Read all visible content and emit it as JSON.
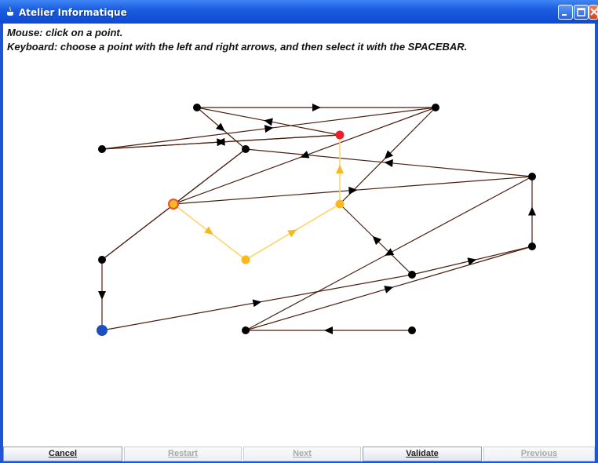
{
  "window": {
    "title": "Atelier Informatique"
  },
  "instructions": {
    "mouse": "Mouse: click on a point.",
    "keyboard": "Keyboard: choose a point with the left and right arrows, and then select it with the SPACEBAR."
  },
  "buttons": {
    "cancel": "Cancel",
    "restart": "Restart",
    "next": "Next",
    "validate": "Validate",
    "previous": "Previous"
  },
  "colors": {
    "edge": "#4a1f10",
    "highlight_edge": "#ffd56a",
    "node": "#000000",
    "arrow": "#000000",
    "path_node": "#f8b820",
    "path_arrow": "#f8b820",
    "start_node": "#e8212b",
    "current_node": "#f8b820",
    "current_ring": "#e8512b",
    "target_node": "#1e4fbf"
  },
  "graph": {
    "nodes": [
      {
        "id": "n1",
        "type": "normal"
      },
      {
        "id": "n2",
        "type": "normal"
      },
      {
        "id": "n3",
        "type": "normal"
      },
      {
        "id": "n4",
        "type": "start"
      },
      {
        "id": "n5",
        "type": "normal"
      },
      {
        "id": "n6",
        "type": "normal"
      },
      {
        "id": "n7",
        "type": "current"
      },
      {
        "id": "n8",
        "type": "path"
      },
      {
        "id": "n9",
        "type": "path"
      },
      {
        "id": "n10",
        "type": "normal"
      },
      {
        "id": "n11",
        "type": "normal"
      },
      {
        "id": "n12",
        "type": "target"
      },
      {
        "id": "n13",
        "type": "normal"
      },
      {
        "id": "n14",
        "type": "normal"
      },
      {
        "id": "n15",
        "type": "normal"
      }
    ],
    "edges": [
      {
        "from": "n1",
        "to": "n2",
        "highlight": false
      },
      {
        "from": "n3",
        "to": "n5",
        "highlight": false
      },
      {
        "from": "n4",
        "to": "n1",
        "highlight": false
      },
      {
        "from": "n4",
        "to": "n3",
        "highlight": false
      },
      {
        "from": "n3",
        "to": "n4",
        "highlight": false
      },
      {
        "from": "n1",
        "to": "n5",
        "highlight": false
      },
      {
        "from": "n2",
        "to": "n6",
        "highlight": false
      },
      {
        "from": "n6",
        "to": "n2",
        "highlight": false
      },
      {
        "from": "n5",
        "to": "n7",
        "highlight": false
      },
      {
        "from": "n7",
        "to": "n10",
        "highlight": false
      },
      {
        "from": "n10",
        "to": "n2",
        "highlight": false
      },
      {
        "from": "n5",
        "to": "n8",
        "highlight": false
      },
      {
        "from": "n7",
        "to": "n9",
        "highlight": true
      },
      {
        "from": "n9",
        "to": "n8",
        "highlight": true
      },
      {
        "from": "n8",
        "to": "n4",
        "highlight": true
      },
      {
        "from": "n11",
        "to": "n8",
        "highlight": false
      },
      {
        "from": "n6",
        "to": "n12",
        "highlight": false
      },
      {
        "from": "n12",
        "to": "n11",
        "highlight": false
      },
      {
        "from": "n11",
        "to": "n13",
        "highlight": false
      },
      {
        "from": "n10",
        "to": "n14",
        "highlight": false
      },
      {
        "from": "n14",
        "to": "n13",
        "highlight": false
      },
      {
        "from": "n13",
        "to": "n10",
        "highlight": false
      },
      {
        "from": "n15",
        "to": "n14",
        "highlight": false
      }
    ]
  }
}
